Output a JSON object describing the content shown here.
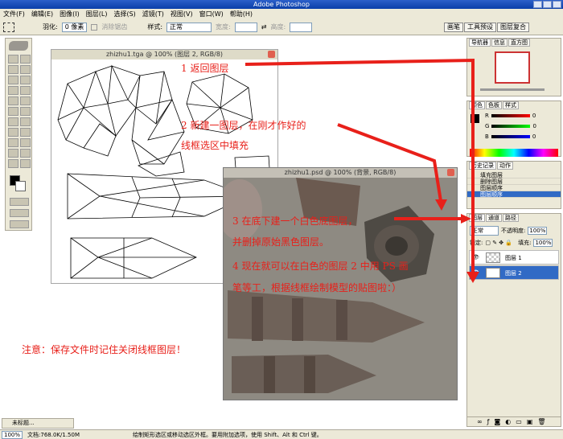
{
  "app": {
    "title": "Adobe Photoshop"
  },
  "menu": [
    "文件(F)",
    "编辑(E)",
    "图像(I)",
    "图层(L)",
    "选择(S)",
    "滤镜(T)",
    "视图(V)",
    "窗口(W)",
    "帮助(H)"
  ],
  "options": {
    "feather_label": "羽化:",
    "feather_value": "0 像素",
    "antialias_label": "消除锯齿",
    "style_label": "样式:",
    "style_value": "正常",
    "width_label": "宽度:",
    "height_label": "高度:",
    "palette_tabs": [
      "画笔",
      "工具预设",
      "图层复合"
    ]
  },
  "doc1": {
    "title": "zhizhu1.tga @ 100% (图层 2, RGB/8)"
  },
  "doc2": {
    "title": "zhizhu1.psd @ 100% (背景, RGB/8)"
  },
  "navigator": {
    "tabs": [
      "导航器",
      "信息",
      "直方图"
    ]
  },
  "color": {
    "tabs": [
      "颜色",
      "色板",
      "样式"
    ],
    "channels": [
      "R",
      "G",
      "B"
    ],
    "values": [
      "0",
      "0",
      "0"
    ]
  },
  "history": {
    "tabs": [
      "历史记录",
      "动作"
    ],
    "items": [
      "填充图层",
      "删除图层",
      "图层顺序",
      "图层顺序"
    ]
  },
  "layers": {
    "tabs": [
      "图层",
      "通道",
      "路径"
    ],
    "blend_mode": "正常",
    "opacity_label": "不透明度:",
    "opacity_value": "100%",
    "lock_label": "锁定:",
    "fill_label": "填充:",
    "fill_value": "100%",
    "rows": [
      "图层 1",
      "图层 2"
    ]
  },
  "annotations": {
    "a1": "1  返回图层",
    "a2": "2  新建一图层，在刚才作好的",
    "a2b": "线框选区中填充",
    "a3": "3 在底下建一个白色底图层，",
    "a3b": "并删掉原始黑色图层。",
    "a4": "4 现在就可以在白色的图层 2 中用 PS 画",
    "a4b": "笔等工，根据线框绘制模型的贴图啦：）",
    "note": "注意：保存文件时记住关闭线框图层！"
  },
  "status": {
    "zoom": "100%",
    "doc_size": "文档:768.0K/1.50M",
    "hint": "绘制矩形选区或移动选区外框。要用附加选项，使用 Shift、Alt 和 Ctrl 键。",
    "minimized": "未标题..."
  },
  "colors": {
    "accent": "#e8201a",
    "selection": "#316ac5",
    "chrome": "#ece9d8"
  }
}
